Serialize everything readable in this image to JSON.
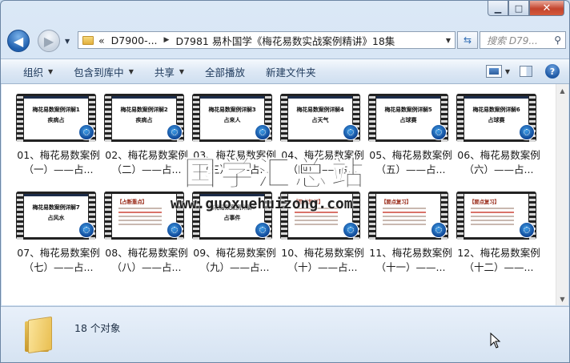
{
  "window": {
    "caption_buttons": {
      "minimize": "▁",
      "maximize": "□",
      "close": "✕"
    }
  },
  "nav": {
    "back": "◀",
    "forward": "▶",
    "address": {
      "overflow": "«",
      "parts": [
        "D7900-...",
        "D7981 易朴国学《梅花易数实战案例精讲》18集"
      ]
    },
    "search_placeholder": "搜索 D79..."
  },
  "toolbar": {
    "items": [
      {
        "label": "组织",
        "has_menu": true
      },
      {
        "label": "包含到库中",
        "has_menu": true
      },
      {
        "label": "共享",
        "has_menu": true
      },
      {
        "label": "全部播放",
        "has_menu": false
      },
      {
        "label": "新建文件夹",
        "has_menu": false
      }
    ],
    "help_label": "?"
  },
  "files": [
    {
      "name": "01、梅花易数案例（一）——占...",
      "thumb_title": "梅花易数案例详解1",
      "thumb_sub": "疾病占",
      "style": "title"
    },
    {
      "name": "02、梅花易数案例（二）——占...",
      "thumb_title": "梅花易数案例详解2",
      "thumb_sub": "疾病占",
      "style": "title"
    },
    {
      "name": "03、梅花易数案例（三）——占...",
      "thumb_title": "梅花易数案例详解3",
      "thumb_sub": "占来人",
      "style": "title"
    },
    {
      "name": "04、梅花易数案例（四）——占...",
      "thumb_title": "梅花易数案例详解4",
      "thumb_sub": "占天气",
      "style": "title"
    },
    {
      "name": "05、梅花易数案例（五）——占...",
      "thumb_title": "梅花易数案例详解5",
      "thumb_sub": "占球赛",
      "style": "title"
    },
    {
      "name": "06、梅花易数案例（六）——占...",
      "thumb_title": "梅花易数案例详解6",
      "thumb_sub": "占球赛",
      "style": "title"
    },
    {
      "name": "07、梅花易数案例（七）——占...",
      "thumb_title": "梅花易数案例详解7",
      "thumb_sub": "占风水",
      "style": "title"
    },
    {
      "name": "08、梅花易数案例（八）——占...",
      "thumb_title": "【占断重点】",
      "thumb_sub": "",
      "style": "slide"
    },
    {
      "name": "09、梅花易数案例（九）——占...",
      "thumb_title": "梅花易数案例详解9",
      "thumb_sub": "占事件",
      "style": "title"
    },
    {
      "name": "10、梅花易数案例（十）——占...",
      "thumb_title": "【要点复习】",
      "thumb_sub": "",
      "style": "slide"
    },
    {
      "name": "11、梅花易数案例（十一）——...",
      "thumb_title": "【要点复习】",
      "thumb_sub": "",
      "style": "slide"
    },
    {
      "name": "12、梅花易数案例（十二）——...",
      "thumb_title": "【要点复习】",
      "thumb_sub": "",
      "style": "slide"
    }
  ],
  "watermark": {
    "text_cn": "国学汇总站",
    "url": "www.guoxuehuizong.com"
  },
  "details": {
    "count_text": "18 个对象"
  },
  "colors": {
    "accent": "#1f5fae",
    "close_red": "#c3442d",
    "content_bg": "#ffffff"
  }
}
